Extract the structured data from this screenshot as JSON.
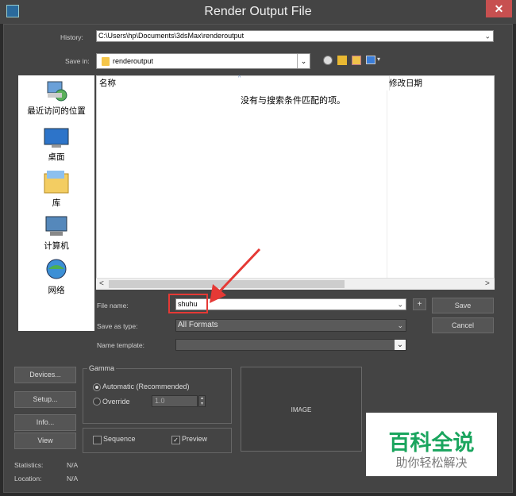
{
  "window": {
    "title": "Render Output File"
  },
  "history": {
    "label": "History:",
    "value": "C:\\Users\\hp\\Documents\\3dsMax\\renderoutput"
  },
  "save_in": {
    "label": "Save in:",
    "value": "renderoutput"
  },
  "sidebar": {
    "items": [
      {
        "label": "最近访问的位置",
        "icon": "recent-places-icon"
      },
      {
        "label": "桌面",
        "icon": "desktop-icon"
      },
      {
        "label": "库",
        "icon": "libraries-icon"
      },
      {
        "label": "计算机",
        "icon": "computer-icon"
      },
      {
        "label": "网络",
        "icon": "network-icon"
      }
    ]
  },
  "file_list": {
    "columns": [
      "名称",
      "修改日期"
    ],
    "empty_message": "没有与搜索条件匹配的项。"
  },
  "file_name": {
    "label": "File name:",
    "value": "shuhu"
  },
  "save_as_type": {
    "label": "Save as type:",
    "value": "All Formats"
  },
  "name_template": {
    "label": "Name template:",
    "value": ""
  },
  "buttons": {
    "plus": "+",
    "save": "Save",
    "cancel": "Cancel",
    "devices": "Devices...",
    "setup": "Setup...",
    "info": "Info...",
    "view": "View"
  },
  "gamma": {
    "title": "Gamma",
    "automatic": "Automatic (Recommended)",
    "override": "Override",
    "override_value": "1.0",
    "selected": "automatic"
  },
  "options": {
    "sequence": "Sequence",
    "sequence_checked": false,
    "preview": "Preview",
    "preview_checked": true
  },
  "image_preview": {
    "label": "IMAGE"
  },
  "statistics": {
    "label": "Statistics:",
    "value": "N/A"
  },
  "location": {
    "label": "Location:",
    "value": "N/A"
  },
  "watermark": {
    "main": "百科全说",
    "sub": "助你轻松解决"
  },
  "colors": {
    "annotation_red": "#e53935",
    "dialog_bg": "#444444"
  }
}
